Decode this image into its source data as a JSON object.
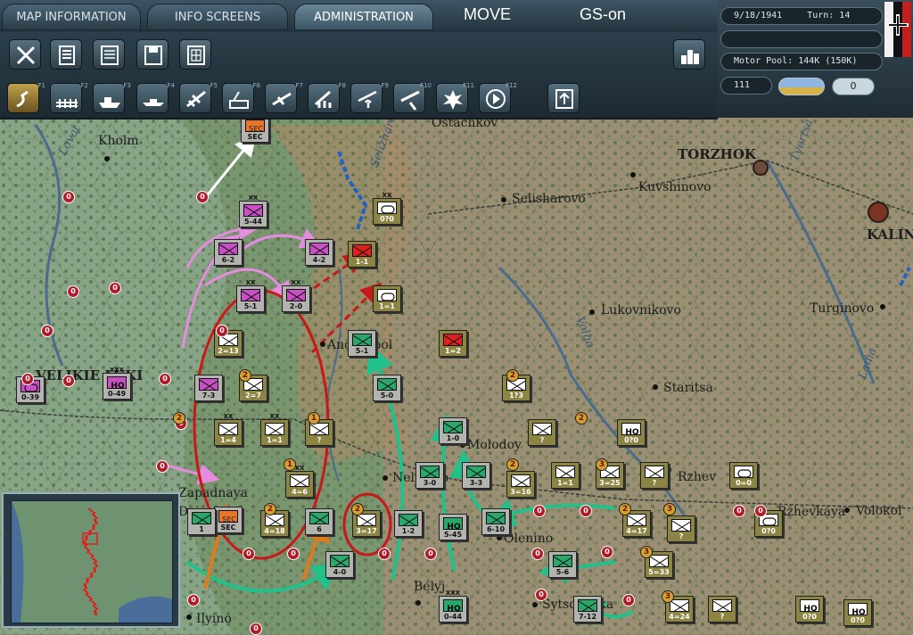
{
  "tabs": [
    {
      "label": "MAP INFORMATION"
    },
    {
      "label": "INFO SCREENS"
    },
    {
      "label": "ADMINISTRATION"
    }
  ],
  "mode": {
    "move": "MOVE",
    "gs": "GS-on"
  },
  "toolbar_keys": [
    "F1",
    "F2",
    "F3",
    "F4",
    "F5",
    "F6",
    "F7",
    "F8",
    "F9",
    "F10",
    "F11",
    "F12"
  ],
  "info": {
    "date": "9/18/1941",
    "turn": "Turn: 14",
    "motor_pool": "Motor Pool: 144K (150K)",
    "ap": "111",
    "counter": "0"
  },
  "towns": [
    "Kholm",
    "Selisharovo",
    "Kuvshinovo",
    "Lukovnikovo",
    "Turginovo",
    "Staritsa",
    "Andreapol",
    "Molodoy",
    "Nelidovo",
    "Zapadnaya",
    "Dvina",
    "Olenino",
    "Belyj",
    "Ilyino",
    "Sytschevka",
    "Volokol",
    "TORZHOK",
    "KALIN",
    "VELIKIE LUKI",
    "Ostachkov",
    "Rzhev",
    "Rzhevkaya"
  ],
  "rivers": [
    "Lovat",
    "Volga",
    "Lama",
    "Tvertsa",
    "Selizharovka"
  ],
  "units": [
    {
      "side": "sov",
      "kind": "inf",
      "value": "5-44",
      "size": "XX"
    },
    {
      "side": "sov",
      "kind": "inf",
      "value": "6-2"
    },
    {
      "side": "sov",
      "kind": "inf",
      "value": "4-2"
    },
    {
      "side": "sov",
      "kind": "inf",
      "value": "5-1",
      "size": "XX"
    },
    {
      "side": "sov",
      "kind": "inf",
      "value": "2-0",
      "size": "XX"
    },
    {
      "side": "sov",
      "kind": "inf",
      "value": "7-3"
    },
    {
      "side": "sov",
      "kind": "hq",
      "value": "0-49",
      "size": "XXX"
    },
    {
      "side": "sov",
      "kind": "arm",
      "value": "0-39"
    },
    {
      "side": "sov",
      "kind": "inf",
      "value": "SEC"
    },
    {
      "side": "ger",
      "kind": "arm",
      "value": "0?0",
      "size": "XX"
    },
    {
      "side": "ger",
      "kind": "inf",
      "value": "1-1"
    },
    {
      "side": "ger",
      "kind": "arm",
      "value": "1=1"
    },
    {
      "side": "ger",
      "kind": "inf",
      "value": "1=2"
    },
    {
      "side": "ger",
      "kind": "inf",
      "value": "2=13"
    },
    {
      "side": "ger",
      "kind": "inf",
      "value": "2=7"
    },
    {
      "side": "ger",
      "kind": "inf",
      "value": "1=4",
      "size": "XX"
    },
    {
      "side": "ger",
      "kind": "inf",
      "value": "1=1",
      "size": "XX"
    },
    {
      "side": "ger",
      "kind": "inf",
      "value": "?"
    },
    {
      "side": "ger",
      "kind": "inf",
      "value": "4=6",
      "size": "XX"
    },
    {
      "side": "ger",
      "kind": "inf",
      "value": "4=18"
    },
    {
      "side": "ger",
      "kind": "inf",
      "value": "3=17"
    },
    {
      "side": "ger",
      "kind": "inf",
      "value": "1?3"
    },
    {
      "side": "ger",
      "kind": "inf",
      "value": "?"
    },
    {
      "side": "ger",
      "kind": "hq",
      "value": "0?0"
    },
    {
      "side": "ger",
      "kind": "inf",
      "value": "3=16"
    },
    {
      "side": "ger",
      "kind": "inf",
      "value": "1=1"
    },
    {
      "side": "ger",
      "kind": "inf",
      "value": "3=25"
    },
    {
      "side": "ger",
      "kind": "inf",
      "value": "?"
    },
    {
      "side": "ger",
      "kind": "arm",
      "value": "0=0"
    },
    {
      "side": "ger",
      "kind": "inf",
      "value": "4=17"
    },
    {
      "side": "ger",
      "kind": "inf",
      "value": "?"
    },
    {
      "side": "ger",
      "kind": "arm",
      "value": "0?0"
    },
    {
      "side": "ger",
      "kind": "inf",
      "value": "5=33"
    },
    {
      "side": "ger",
      "kind": "inf",
      "value": "4=24"
    },
    {
      "side": "ger",
      "kind": "inf",
      "value": "?"
    },
    {
      "side": "ger",
      "kind": "hq",
      "value": "0?0"
    },
    {
      "side": "ger",
      "kind": "hq",
      "value": "0?0"
    },
    {
      "side": "sov",
      "kind": "inf",
      "value": "5-1"
    },
    {
      "side": "sov",
      "kind": "inf",
      "value": "5-0"
    },
    {
      "side": "sov",
      "kind": "inf",
      "value": "1-0"
    },
    {
      "side": "sov",
      "kind": "inf",
      "value": "3-0"
    },
    {
      "side": "sov",
      "kind": "inf",
      "value": "3-3"
    },
    {
      "side": "sov",
      "kind": "inf",
      "value": "1-2"
    },
    {
      "side": "sov",
      "kind": "hq",
      "value": "5-45"
    },
    {
      "side": "sov",
      "kind": "inf",
      "value": "6-10"
    },
    {
      "side": "sov",
      "kind": "inf",
      "value": "4-0"
    },
    {
      "side": "sov",
      "kind": "inf",
      "value": "5-6"
    },
    {
      "side": "sov",
      "kind": "inf",
      "value": "7-12"
    },
    {
      "side": "sov",
      "kind": "hq",
      "value": "0-44",
      "size": "XXX"
    },
    {
      "side": "sov",
      "kind": "inf",
      "value": "SEC"
    },
    {
      "side": "sov",
      "kind": "inf",
      "value": "1"
    },
    {
      "side": "sov",
      "kind": "inf",
      "value": "6"
    }
  ]
}
